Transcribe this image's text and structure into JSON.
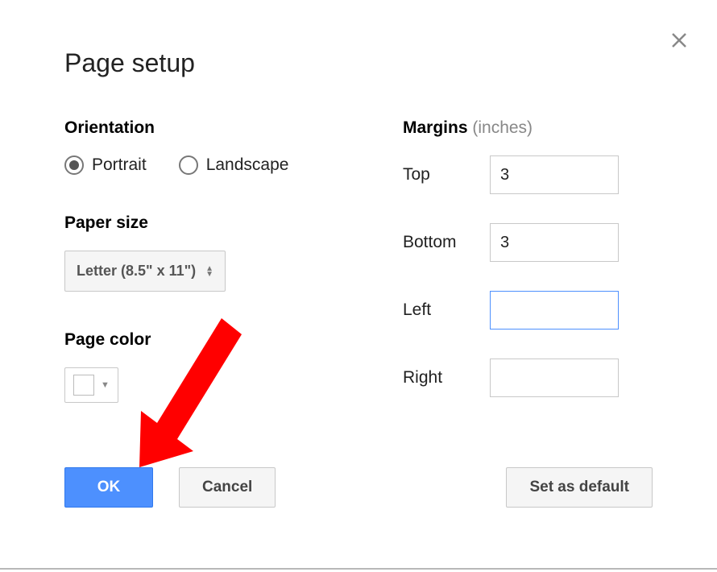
{
  "dialog": {
    "title": "Page setup"
  },
  "orientation": {
    "label": "Orientation",
    "portrait": "Portrait",
    "landscape": "Landscape",
    "selected": "portrait"
  },
  "paper_size": {
    "label": "Paper size",
    "selected": "Letter (8.5\" x 11\")"
  },
  "page_color": {
    "label": "Page color",
    "value": "#ffffff"
  },
  "margins": {
    "label": "Margins",
    "units": "(inches)",
    "top_label": "Top",
    "top_value": "3",
    "bottom_label": "Bottom",
    "bottom_value": "3",
    "left_label": "Left",
    "left_value": "",
    "right_label": "Right",
    "right_value": ""
  },
  "buttons": {
    "ok": "OK",
    "cancel": "Cancel",
    "set_default": "Set as default"
  }
}
